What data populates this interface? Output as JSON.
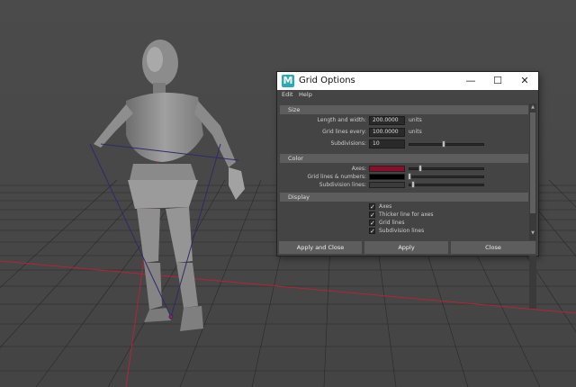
{
  "dialog": {
    "title": "Grid Options",
    "app_icon": "M",
    "window_controls": {
      "minimize": "—",
      "maximize": "☐",
      "close": "✕"
    },
    "menu": [
      "Edit",
      "Help"
    ],
    "sections": {
      "size": {
        "header": "Size",
        "length_label": "Length and width:",
        "length_value": "200.0000",
        "length_unit": "units",
        "lines_label": "Grid lines every:",
        "lines_value": "100.0000",
        "lines_unit": "units",
        "subdiv_label": "Subdivisions:",
        "subdiv_value": "10"
      },
      "color": {
        "header": "Color",
        "axes_label": "Axes:",
        "axes_color": "#8b0e2a",
        "gridnum_label": "Grid lines & numbers:",
        "gridnum_color": "#000000",
        "subdiv_lines_label": "Subdivision lines:"
      },
      "display": {
        "header": "Display",
        "options": [
          {
            "label": "Axes",
            "checked": true
          },
          {
            "label": "Thicker line for axes",
            "checked": true
          },
          {
            "label": "Grid lines",
            "checked": true
          },
          {
            "label": "Subdivision lines",
            "checked": true
          }
        ]
      }
    },
    "buttons": {
      "apply_close": "Apply and Close",
      "apply": "Apply",
      "close": "Close"
    }
  }
}
